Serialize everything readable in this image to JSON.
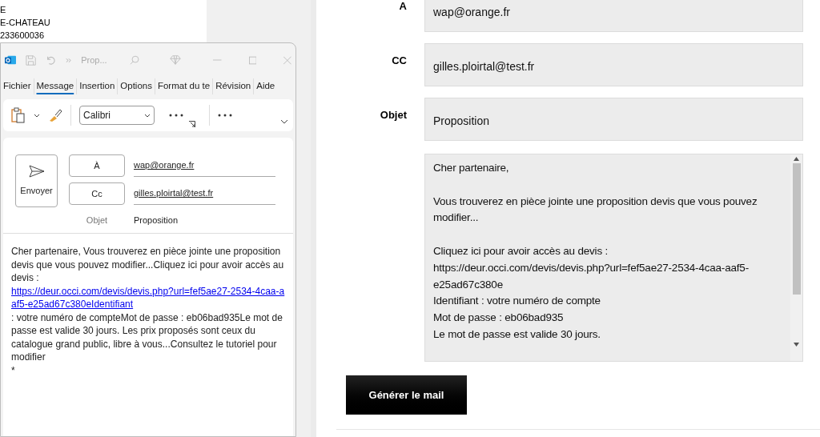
{
  "background_document": {
    "lines": [
      "E",
      "E-CHATEAU",
      "233600036"
    ]
  },
  "mail_window": {
    "title": "Prop...",
    "tabs": [
      {
        "label": "Fichier",
        "selected": false
      },
      {
        "label": "Message",
        "selected": true
      },
      {
        "label": "Insertion",
        "selected": false
      },
      {
        "label": "Options",
        "selected": false
      },
      {
        "label": "Format du te",
        "selected": false
      },
      {
        "label": "Révision",
        "selected": false
      },
      {
        "label": "Aide",
        "selected": false
      }
    ],
    "font": "Calibri",
    "send_button": "Envoyer",
    "to_button": "À",
    "to_value": "wap@orange.fr",
    "cc_button": "Cc",
    "cc_value": "gilles.ploirtal@test.fr",
    "subject_label": "Objet",
    "subject_value": "Proposition",
    "body": {
      "intro": "Cher partenaire, Vous trouverez en pièce jointe une proposition devis que vous pouvez modifier...Cliquez ici pour avoir accès au devis : ",
      "link": "https://deur.occi.com/devis/devis.php?url=fef5ae27-2534-4caa-aaf5-e25ad67c380eIdentifiant",
      "rest": " : votre numéro de compteMot de passe : eb06bad935Le mot de passe est valide 30 jours. Les prix proposés sont ceux du catalogue grand public, libre à vous...Consultez le tutoriel pour modifier",
      "end": "*"
    }
  },
  "form": {
    "fields": [
      {
        "label": "A",
        "value": "wap@orange.fr"
      },
      {
        "label": "CC",
        "value": "gilles.ploirtal@test.fr"
      },
      {
        "label": "Objet",
        "value": "Proposition"
      }
    ],
    "message": "Cher partenaire,\n\nVous trouverez en pièce jointe une proposition devis que vous pouvez modifier...\n\nCliquez ici pour avoir accès au devis :\nhttps://deur.occi.com/devis/devis.php?url=fef5ae27-2534-4caa-aaf5-e25ad67c380e\nIdentifiant : votre numéro de compte\nMot de passe : eb06bad935\nLe mot de passe est valide 30 jours.",
    "button": "Générer le mail"
  }
}
